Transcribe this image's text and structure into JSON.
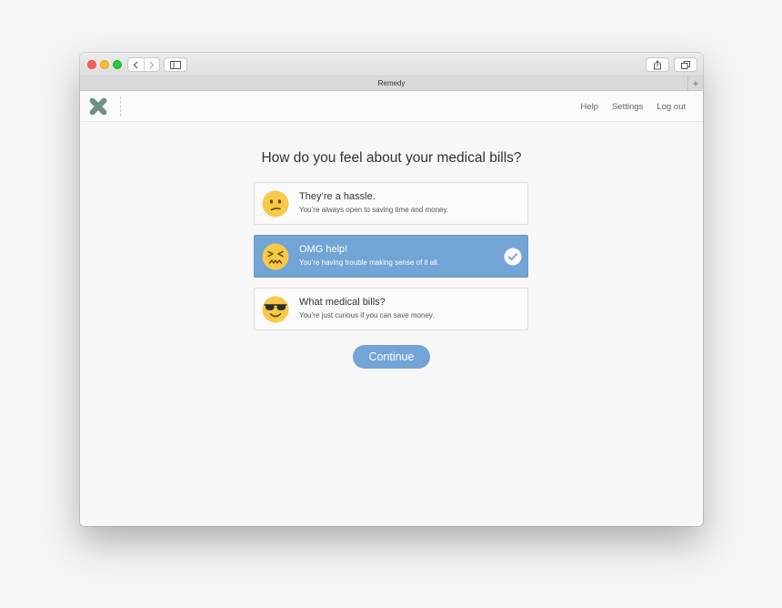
{
  "browser": {
    "tab_title": "Remedy",
    "new_tab": "+"
  },
  "header": {
    "links": [
      "Help",
      "Settings",
      "Log out"
    ]
  },
  "main": {
    "question": "How do you feel about your medical bills?",
    "options": [
      {
        "title": "They’re a hassle.",
        "subtitle": "You’re always open to saving time and money.",
        "icon": "confused-face-icon",
        "selected": false
      },
      {
        "title": "OMG help!",
        "subtitle": "You’re having trouble making sense of it all.",
        "icon": "confounded-face-icon",
        "selected": true
      },
      {
        "title": "What medical bills?",
        "subtitle": "You’re just curious if you can save money.",
        "icon": "sunglasses-face-icon",
        "selected": false
      }
    ],
    "continue_label": "Continue"
  },
  "colors": {
    "accent": "#72a4d6",
    "logo": "#6f8f80",
    "emoji_yellow": "#f7c948"
  }
}
